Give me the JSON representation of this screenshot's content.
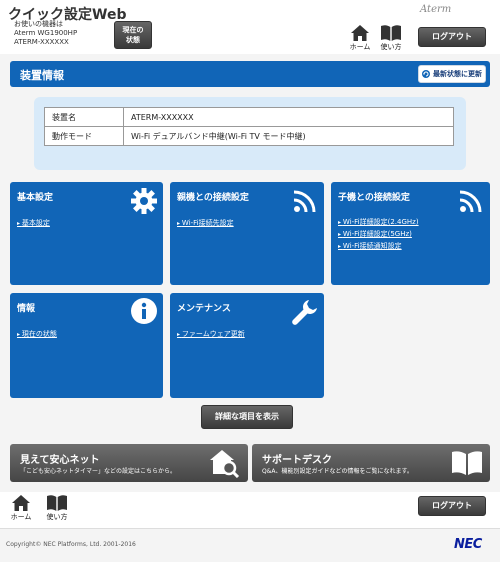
{
  "header": {
    "title": "クイック設定Web",
    "device_line1": "お使いの機器は",
    "device_line2": "Aterm WG1900HP",
    "device_line3": "ATERM-XXXXXX",
    "status_button_line1": "現在の",
    "status_button_line2": "状態",
    "brand": "Aterm",
    "home_label": "ホーム",
    "manual_label": "使い方",
    "logout_label": "ログアウト"
  },
  "device_info": {
    "title": "装置情報",
    "refresh_label": "最新状態に更新",
    "rows": [
      {
        "key": "装置名",
        "value": "ATERM-XXXXXX"
      },
      {
        "key": "動作モード",
        "value": "Wi-Fi デュアルバンド中継(Wi-Fi TV モード中継)"
      }
    ]
  },
  "tiles": [
    {
      "title": "基本設定",
      "icon": "gear-icon",
      "links": [
        "基本設定"
      ]
    },
    {
      "title": "親機との接続設定",
      "icon": "wifi-icon",
      "links": [
        "Wi-Fi接続先設定"
      ]
    },
    {
      "title": "子機との接続設定",
      "icon": "wifi-icon",
      "links": [
        "Wi-Fi詳細設定(2.4GHz)",
        "Wi-Fi詳細設定(5GHz)",
        "Wi-Fi接続通知設定"
      ]
    },
    {
      "title": "情報",
      "icon": "info-icon",
      "links": [
        "現在の状態"
      ]
    },
    {
      "title": "メンテナンス",
      "icon": "wrench-icon",
      "links": [
        "ファームウェア更新"
      ]
    }
  ],
  "detail_button": "詳細な項目を表示",
  "banners": [
    {
      "title": "見えて安心ネット",
      "subtitle": "「こども安心ネットタイマー」などの設定はこちらから。",
      "icon": "house-search-icon"
    },
    {
      "title": "サポートデスク",
      "subtitle": "Q&A、機能別設定ガイドなどの情報をご覧になれます。",
      "icon": "book-icon"
    }
  ],
  "footer": {
    "home_label": "ホーム",
    "manual_label": "使い方",
    "logout_label": "ログアウト",
    "copyright": "Copyright© NEC Platforms, Ltd. 2001-2016",
    "logo": "NEC"
  },
  "colors": {
    "accent": "#1165b7",
    "button_dark": "#444444",
    "info_bg": "#d8eaf9"
  }
}
